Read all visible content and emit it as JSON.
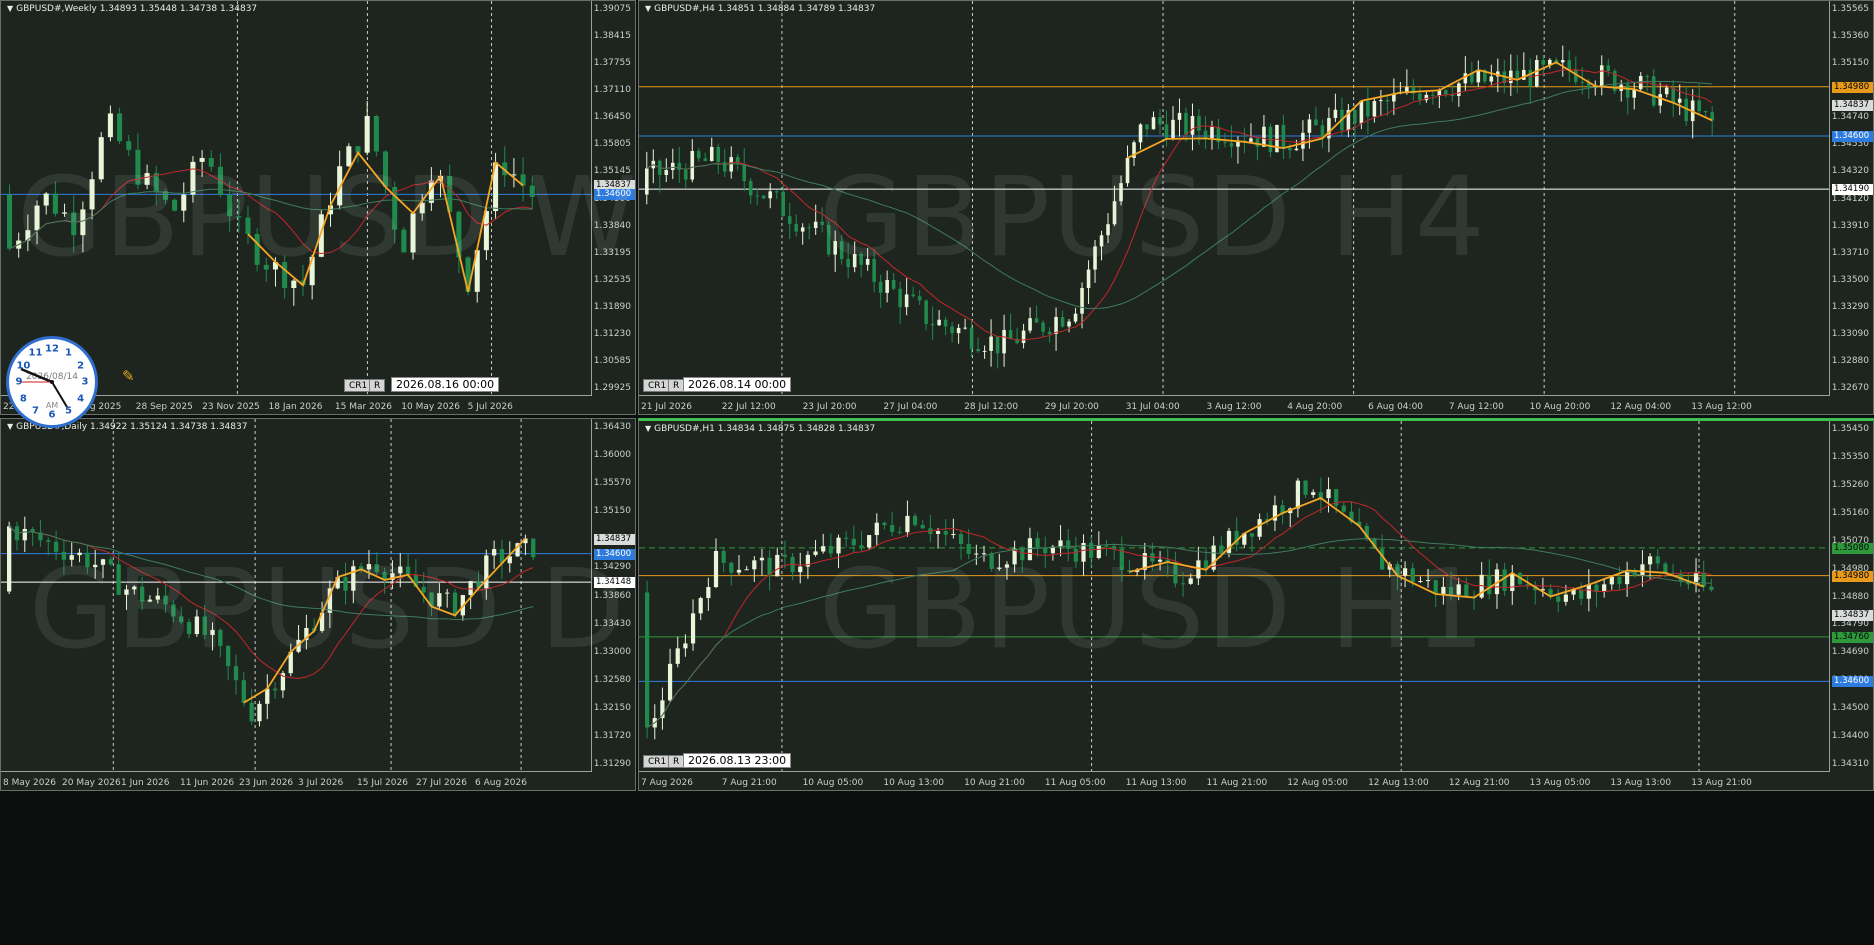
{
  "colors": {
    "bg": "#1e251f",
    "up": "#e8f5d8",
    "down": "#1f8a4c",
    "ma_red": "#c2262b",
    "ma_green": "#3f7b5c",
    "zigzag": "#f5a623",
    "hline_blue": "#2e7be0",
    "hline_white": "#ffffff",
    "hline_orange": "#e89a1b",
    "hline_green": "#2e9a3b"
  },
  "charts": [
    {
      "id": "w1",
      "header": "GBPUSD#,Weekly  1.34893 1.35448 1.34738 1.34837",
      "watermark": "GBPUSD W1",
      "yticks": [
        "1.39075",
        "1.38415",
        "1.37755",
        "1.37110",
        "1.36450",
        "1.35805",
        "1.35145",
        "1.34500",
        "1.33840",
        "1.33195",
        "1.32535",
        "1.31890",
        "1.31230",
        "1.30585",
        "1.29925"
      ],
      "ymin": 1.29925,
      "ymax": 1.39075,
      "xticks": [
        "22 Jun 2025",
        "3 Aug 2025",
        "28 Sep 2025",
        "23 Nov 2025",
        "18 Jan 2026",
        "15 Mar 2026",
        "10 May 2026",
        "5 Jul 2026"
      ],
      "price_tags": [
        {
          "label": "1.34837",
          "value": 1.34837,
          "bg": "#d9dcdb",
          "fg": "#000"
        },
        {
          "label": "1.34600",
          "value": 1.346,
          "bg": "#2e7be0",
          "fg": "#fff"
        }
      ],
      "hlines": [
        {
          "value": 1.346,
          "color": "#2e7be0",
          "dash": false
        }
      ],
      "buttons": [
        "CR1",
        "R"
      ],
      "date": "2026.08.16 00:00"
    },
    {
      "id": "h4",
      "header": "GBPUSD#,H4  1.34851 1.34884 1.34789 1.34837",
      "watermark": "GBPUSD H4",
      "yticks": [
        "1.35565",
        "1.35360",
        "1.35150",
        "1.34950",
        "1.34740",
        "1.34530",
        "1.34320",
        "1.34120",
        "1.33910",
        "1.33710",
        "1.33500",
        "1.33290",
        "1.33090",
        "1.32880",
        "1.32670"
      ],
      "ymin": 1.3267,
      "ymax": 1.35565,
      "xticks": [
        "21 Jul 2026",
        "22 Jul 12:00",
        "23 Jul 20:00",
        "27 Jul 04:00",
        "28 Jul 12:00",
        "29 Jul 20:00",
        "31 Jul 04:00",
        "3 Aug 12:00",
        "4 Aug 20:00",
        "6 Aug 04:00",
        "7 Aug 12:00",
        "10 Aug 20:00",
        "12 Aug 04:00",
        "13 Aug 12:00"
      ],
      "price_tags": [
        {
          "label": "1.34980",
          "value": 1.3498,
          "bg": "#e89a1b",
          "fg": "#000"
        },
        {
          "label": "1.34837",
          "value": 1.34837,
          "bg": "#d9dcdb",
          "fg": "#000"
        },
        {
          "label": "1.34600",
          "value": 1.346,
          "bg": "#2e7be0",
          "fg": "#fff"
        },
        {
          "label": "1.34190",
          "value": 1.3419,
          "bg": "#ffffff",
          "fg": "#000"
        }
      ],
      "hlines": [
        {
          "value": 1.3498,
          "color": "#e89a1b",
          "dash": false
        },
        {
          "value": 1.346,
          "color": "#2e7be0",
          "dash": false
        },
        {
          "value": 1.3419,
          "color": "#ffffff",
          "dash": false
        }
      ],
      "buttons": [
        "CR1",
        "R"
      ],
      "date": "2026.08.14 00:00"
    },
    {
      "id": "d1",
      "header": "GBPUSD#,Daily  1.34922 1.35124 1.34738 1.34837",
      "watermark": "GBPUSD D1",
      "yticks": [
        "1.36430",
        "1.36000",
        "1.35570",
        "1.35150",
        "1.34720",
        "1.34290",
        "1.33860",
        "1.33430",
        "1.33000",
        "1.32580",
        "1.32150",
        "1.31720",
        "1.31290"
      ],
      "ymin": 1.3129,
      "ymax": 1.3658,
      "xticks": [
        "8 May 2026",
        "20 May 2026",
        "1 Jun 2026",
        "11 Jun 2026",
        "23 Jun 2026",
        "3 Jul 2026",
        "15 Jul 2026",
        "27 Jul 2026",
        "6 Aug 2026"
      ],
      "price_tags": [
        {
          "label": "1.34837",
          "value": 1.34837,
          "bg": "#d9dcdb",
          "fg": "#000"
        },
        {
          "label": "1.34600",
          "value": 1.346,
          "bg": "#2e7be0",
          "fg": "#fff"
        },
        {
          "label": "1.34148",
          "value": 1.34148,
          "bg": "#ffffff",
          "fg": "#000"
        }
      ],
      "hlines": [
        {
          "value": 1.346,
          "color": "#2e7be0",
          "dash": false
        },
        {
          "value": 1.34148,
          "color": "#ffffff",
          "dash": false
        }
      ],
      "buttons": [],
      "date": ""
    },
    {
      "id": "h1",
      "header": "GBPUSD#,H1  1.34834 1.34875 1.34828 1.34837",
      "watermark": "GBPUSD H1",
      "yticks": [
        "1.35450",
        "1.35350",
        "1.35260",
        "1.35160",
        "1.35070",
        "1.34980",
        "1.34880",
        "1.34790",
        "1.34690",
        "1.34600",
        "1.34500",
        "1.34400",
        "1.34310"
      ],
      "ymin": 1.3431,
      "ymax": 1.355,
      "xticks": [
        "7 Aug 2026",
        "7 Aug 21:00",
        "10 Aug 05:00",
        "10 Aug 13:00",
        "10 Aug 21:00",
        "11 Aug 05:00",
        "11 Aug 13:00",
        "11 Aug 21:00",
        "12 Aug 05:00",
        "12 Aug 13:00",
        "12 Aug 21:00",
        "13 Aug 05:00",
        "13 Aug 13:00",
        "13 Aug 21:00"
      ],
      "price_tags": [
        {
          "label": "1.35080",
          "value": 1.3508,
          "bg": "#2e9a3b",
          "fg": "#000"
        },
        {
          "label": "1.34980",
          "value": 1.3498,
          "bg": "#e89a1b",
          "fg": "#000"
        },
        {
          "label": "1.34837",
          "value": 1.34837,
          "bg": "#d9dcdb",
          "fg": "#000"
        },
        {
          "label": "1.34760",
          "value": 1.3476,
          "bg": "#2e9a3b",
          "fg": "#000"
        },
        {
          "label": "1.34600",
          "value": 1.346,
          "bg": "#2e7be0",
          "fg": "#fff"
        }
      ],
      "hlines": [
        {
          "value": 1.3508,
          "color": "#2e9a3b",
          "dash": true
        },
        {
          "value": 1.3498,
          "color": "#e89a1b",
          "dash": false
        },
        {
          "value": 1.3476,
          "color": "#2e9a3b",
          "dash": false
        },
        {
          "value": 1.346,
          "color": "#2e7be0",
          "dash": false
        }
      ],
      "buttons": [
        "CR1",
        "R"
      ],
      "date": "2026.08.13 23:00"
    }
  ],
  "clock": {
    "date": "2026/08/14",
    "ampm": "AM",
    "numbers": [
      "12",
      "1",
      "2",
      "3",
      "4",
      "5",
      "6",
      "7",
      "8",
      "9",
      "10",
      "11"
    ]
  }
}
